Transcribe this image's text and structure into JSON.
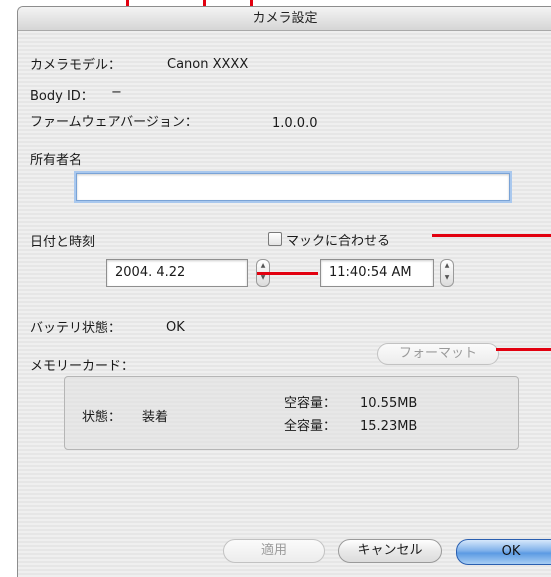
{
  "window": {
    "title": "カメラ設定"
  },
  "camera": {
    "model_label": "カメラモデル：",
    "model_value": "Canon XXXX",
    "body_id_label": "Body ID：",
    "body_id_value": "−",
    "firmware_label": "ファームウェアバージョン：",
    "firmware_value": "1.0.0.0"
  },
  "owner": {
    "label": "所有者名",
    "value": ""
  },
  "datetime": {
    "label": "日付と時刻",
    "sync_label": "マックに合わせる",
    "sync_checked": false,
    "date_value": "2004.  4.22",
    "time_value": "11:40:54 AM"
  },
  "battery": {
    "label": "バッテリ状態：",
    "value": "OK"
  },
  "memory_card": {
    "label": "メモリーカード：",
    "format_button": "フォーマット",
    "status_label": "状態：",
    "status_value": "装着",
    "free_label": "空容量：",
    "free_value": "10.55MB",
    "total_label": "全容量：",
    "total_value": "15.23MB"
  },
  "buttons": {
    "apply": "適用",
    "cancel": "キャンセル",
    "ok": "OK"
  },
  "colors": {
    "callout": "#e2000f",
    "default_button": "#5c9be3",
    "focus_ring": "#a9c8ee"
  }
}
